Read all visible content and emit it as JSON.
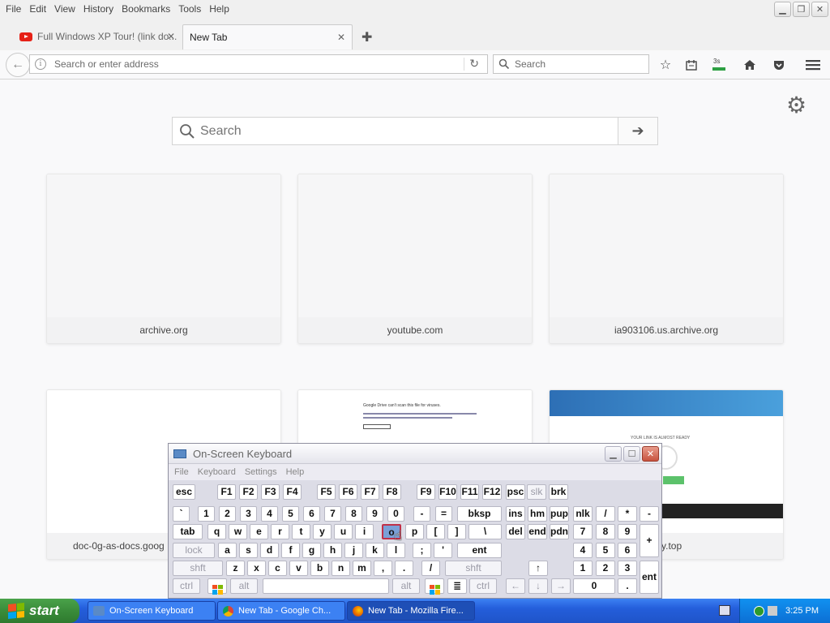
{
  "menubar": {
    "items": [
      "File",
      "Edit",
      "View",
      "History",
      "Bookmarks",
      "Tools",
      "Help"
    ]
  },
  "tabs": [
    {
      "title": "Full Windows XP Tour! (link do...",
      "icon": "youtube-icon",
      "active": false
    },
    {
      "title": "New Tab",
      "active": true
    }
  ],
  "navbar": {
    "url_placeholder": "Search or enter address",
    "search_placeholder": "Search"
  },
  "newtab": {
    "search_placeholder": "Search",
    "tiles": [
      {
        "label": "archive.org"
      },
      {
        "label": "youtube.com"
      },
      {
        "label": "ia903106.us.archive.org"
      },
      {
        "label": "doc-0g-as-docs.goog"
      },
      {
        "label": ""
      },
      {
        "label": "y.top"
      }
    ],
    "tile5_text": "Google Drive can't scan this file for viruses.",
    "tile6_banner": "YOUR LINK IS ALMOST READY"
  },
  "osk": {
    "title": "On-Screen Keyboard",
    "menu": [
      "File",
      "Keyboard",
      "Settings",
      "Help"
    ],
    "rows": {
      "fn": [
        "esc",
        "F1",
        "F2",
        "F3",
        "F4",
        "F5",
        "F6",
        "F7",
        "F8",
        "F9",
        "F10",
        "F11",
        "F12",
        "psc",
        "slk",
        "brk"
      ],
      "num": [
        "`",
        "1",
        "2",
        "3",
        "4",
        "5",
        "6",
        "7",
        "8",
        "9",
        "0",
        "-",
        "=",
        "bksp",
        "ins",
        "hm",
        "pup",
        "nlk",
        "/",
        "*",
        "-"
      ],
      "q": [
        "tab",
        "q",
        "w",
        "e",
        "r",
        "t",
        "y",
        "u",
        "i",
        "o",
        "p",
        "[",
        "]",
        "\\",
        "del",
        "end",
        "pdn",
        "7",
        "8",
        "9",
        "+"
      ],
      "a": [
        "lock",
        "a",
        "s",
        "d",
        "f",
        "g",
        "h",
        "j",
        "k",
        "l",
        ";",
        "'",
        "ent",
        "4",
        "5",
        "6"
      ],
      "z": [
        "shft",
        "z",
        "x",
        "c",
        "v",
        "b",
        "n",
        "m",
        ",",
        ".",
        "/",
        "shft",
        "↑",
        "1",
        "2",
        "3",
        "ent"
      ],
      "sp": [
        "ctrl",
        "alt",
        "alt",
        "ctrl",
        "←",
        "↓",
        "→",
        "0",
        "."
      ]
    },
    "active_key": "o"
  },
  "taskbar": {
    "start_label": "start",
    "tasks": [
      {
        "label": "On-Screen Keyboard",
        "active": false
      },
      {
        "label": "New Tab - Google Ch...",
        "active": false
      },
      {
        "label": "New Tab - Mozilla Fire...",
        "active": true
      }
    ],
    "clock": "3:25 PM"
  },
  "colors": {
    "taskbar_blue": "#245edb",
    "start_green": "#3a8c3a",
    "osk_bg": "#dcdce6",
    "active_key": "#7aa0d8"
  }
}
